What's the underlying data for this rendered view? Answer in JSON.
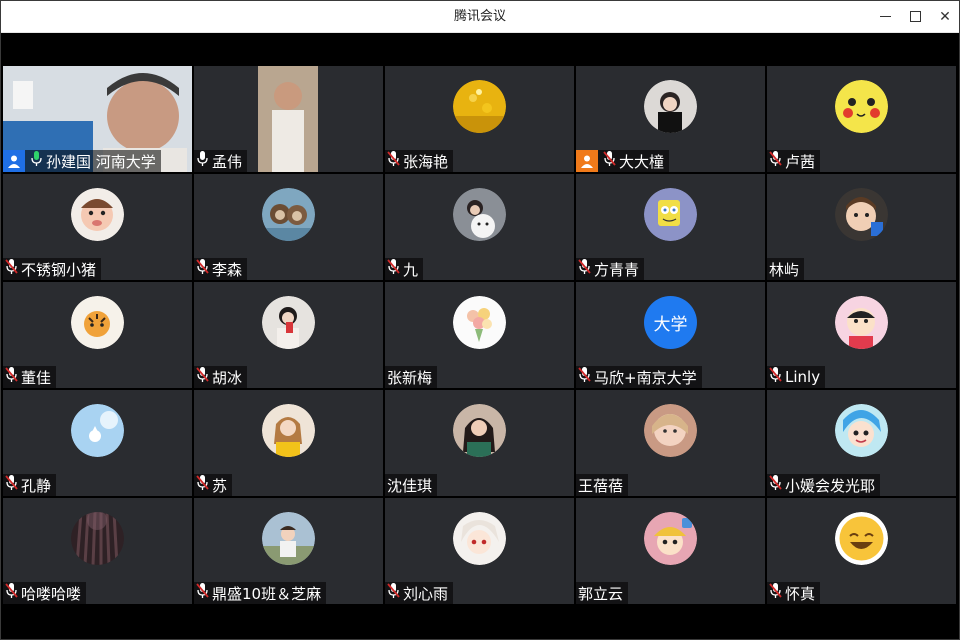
{
  "window": {
    "title": "腾讯会议"
  },
  "colors": {
    "tile_bg": "#2a2c30",
    "active_border": "#2fd36b",
    "host_blue": "#1f6fe5",
    "host_orange": "#f07a1a",
    "mic_muted": "#d12a2a",
    "mic_active": "#2fd36b",
    "avatar_text_bg": "#1f7af0"
  },
  "participants": [
    {
      "name": "孙建国 河南大学",
      "mic": "active",
      "role": "host",
      "video": "on"
    },
    {
      "name": "孟伟",
      "mic": "on",
      "role": "",
      "video": "on"
    },
    {
      "name": "张海艳",
      "mic": "muted",
      "role": "",
      "avatar": "flower-field"
    },
    {
      "name": "大大橦",
      "mic": "muted",
      "role": "cohost",
      "avatar": "person"
    },
    {
      "name": "卢茜",
      "mic": "muted",
      "role": "",
      "avatar": "pikachu"
    },
    {
      "name": "不锈钢小猪",
      "mic": "muted",
      "role": "",
      "avatar": "doll"
    },
    {
      "name": "李森",
      "mic": "muted",
      "role": "",
      "avatar": "otters"
    },
    {
      "name": "九",
      "mic": "muted",
      "role": "",
      "avatar": "girl-bear"
    },
    {
      "name": "方青青",
      "mic": "muted",
      "role": "",
      "avatar": "spongebob"
    },
    {
      "name": "林屿",
      "mic": "none",
      "role": "",
      "avatar": "toddler"
    },
    {
      "name": "董佳",
      "mic": "muted",
      "role": "",
      "avatar": "tiger"
    },
    {
      "name": "胡冰",
      "mic": "muted",
      "role": "",
      "avatar": "woman-phone"
    },
    {
      "name": "张新梅",
      "mic": "none",
      "role": "",
      "avatar": "bouquet"
    },
    {
      "name": "马欣+南京大学",
      "mic": "muted",
      "role": "",
      "avatar_text": "大学"
    },
    {
      "name": "Linly",
      "mic": "muted",
      "role": "",
      "avatar": "crayon-shin"
    },
    {
      "name": "孔静",
      "mic": "muted",
      "role": "",
      "avatar": "sky-cat"
    },
    {
      "name": "苏",
      "mic": "muted",
      "role": "",
      "avatar": "woman-yellow"
    },
    {
      "name": "沈佳琪",
      "mic": "none",
      "role": "",
      "avatar": "woman-dark-hair"
    },
    {
      "name": "王蓓蓓",
      "mic": "none",
      "role": "",
      "avatar": "girl-face"
    },
    {
      "name": "小媛会发光耶",
      "mic": "muted",
      "role": "",
      "avatar": "cartoon-blue-hair"
    },
    {
      "name": "哈喽哈喽",
      "mic": "muted",
      "role": "",
      "avatar": "forest"
    },
    {
      "name": "鼎盛10班＆芝麻",
      "mic": "muted",
      "role": "",
      "avatar": "child-outdoor"
    },
    {
      "name": "刘心雨",
      "mic": "muted",
      "role": "",
      "avatar": "anime-white-hair"
    },
    {
      "name": "郭立云",
      "mic": "none",
      "role": "",
      "avatar": "cartoon-kid"
    },
    {
      "name": "怀真",
      "mic": "muted",
      "role": "",
      "avatar": "smile-emoji"
    }
  ]
}
